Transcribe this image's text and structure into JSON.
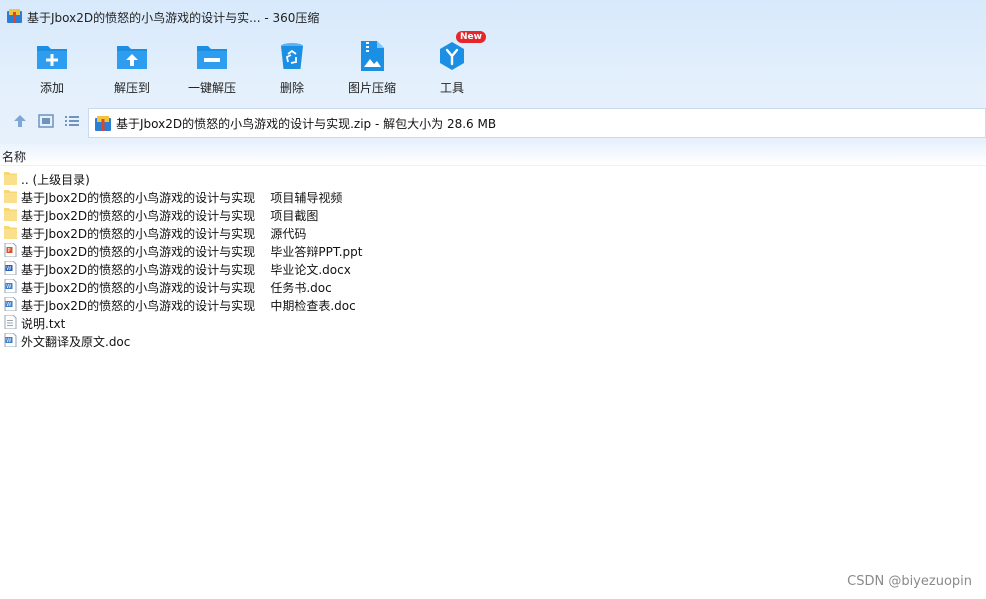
{
  "window": {
    "title": "基于Jbox2D的愤怒的小鸟游戏的设计与实...  - 360压缩"
  },
  "toolbar": {
    "items": [
      {
        "label": "添加",
        "icon": "folder-add-icon"
      },
      {
        "label": "解压到",
        "icon": "folder-extract-icon"
      },
      {
        "label": "一键解压",
        "icon": "folder-quick-extract-icon"
      },
      {
        "label": "删除",
        "icon": "recycle-bin-icon"
      },
      {
        "label": "图片压缩",
        "icon": "image-compress-icon"
      },
      {
        "label": "工具",
        "icon": "tools-icon",
        "badge": "New"
      }
    ]
  },
  "navbar": {
    "path": "基于Jbox2D的愤怒的小鸟游戏的设计与实现.zip - 解包大小为 28.6 MB"
  },
  "list": {
    "column_name": "名称",
    "rows": [
      {
        "name": ".. (上级目录)",
        "type": "folder"
      },
      {
        "name": "基于Jbox2D的愤怒的小鸟游戏的设计与实现    项目辅导视频",
        "type": "folder"
      },
      {
        "name": "基于Jbox2D的愤怒的小鸟游戏的设计与实现    项目截图",
        "type": "folder"
      },
      {
        "name": "基于Jbox2D的愤怒的小鸟游戏的设计与实现    源代码",
        "type": "folder"
      },
      {
        "name": "基于Jbox2D的愤怒的小鸟游戏的设计与实现    毕业答辩PPT.ppt",
        "type": "ppt"
      },
      {
        "name": "基于Jbox2D的愤怒的小鸟游戏的设计与实现    毕业论文.docx",
        "type": "docx"
      },
      {
        "name": "基于Jbox2D的愤怒的小鸟游戏的设计与实现    任务书.doc",
        "type": "doc"
      },
      {
        "name": "基于Jbox2D的愤怒的小鸟游戏的设计与实现    中期检查表.doc",
        "type": "doc"
      },
      {
        "name": "说明.txt",
        "type": "txt"
      },
      {
        "name": "外文翻译及原文.doc",
        "type": "doc"
      }
    ]
  },
  "watermark": "CSDN @biyezuopin",
  "colors": {
    "accent": "#1a8fe3",
    "folder": "#f7d774",
    "badge": "#e5262a"
  }
}
